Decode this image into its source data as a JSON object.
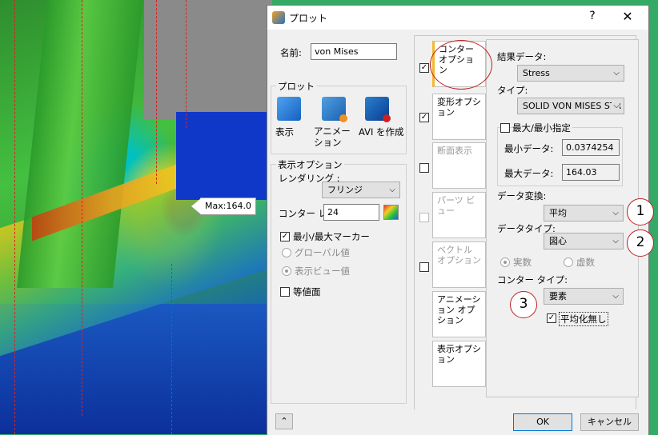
{
  "viewport": {
    "max_label": "Max:164.0"
  },
  "dialog": {
    "title": "プロット",
    "help": "?",
    "close": "✕",
    "name_label": "名前:",
    "name_value": "von Mises",
    "plot_group": "プロット",
    "plot_buttons": [
      "表示",
      "アニメーション",
      "AVI を作成"
    ],
    "display_group": "表示オプション",
    "rendering_label": "レンダリング :",
    "rendering_value": "フリンジ",
    "contour_label": "コンター レ",
    "contour_value": "24",
    "minmax_marker": "最小/最大マーカー",
    "global_value": "グローバル値",
    "view_value": "表示ビュー値",
    "isosurface": "等値面",
    "tabs": [
      "コンター オプション",
      "変形オプション",
      "断面表示",
      "パーツ ビュー",
      "ベクトル オプション",
      "アニメーション オプション",
      "表示オプション"
    ],
    "results_label": "結果データ:",
    "results_value": "Stress",
    "type_label": "タイプ:",
    "type_value": "SOLID VON MISES STR",
    "minmax_specify": "最大/最小指定",
    "min_label": "最小データ:",
    "min_value": "0.0374254",
    "max_label": "最大データ:",
    "max_value": "164.03",
    "conv_label": "データ変換:",
    "conv_value": "平均",
    "dtype_label": "データタイプ:",
    "dtype_value": "図心",
    "real": "実数",
    "imag": "虚数",
    "ctype_label": "コンター タイプ:",
    "ctype_value": "要素",
    "no_avg": "平均化無し",
    "ok": "OK",
    "cancel": "キャンセル",
    "callouts": [
      "1",
      "2",
      "3"
    ]
  }
}
